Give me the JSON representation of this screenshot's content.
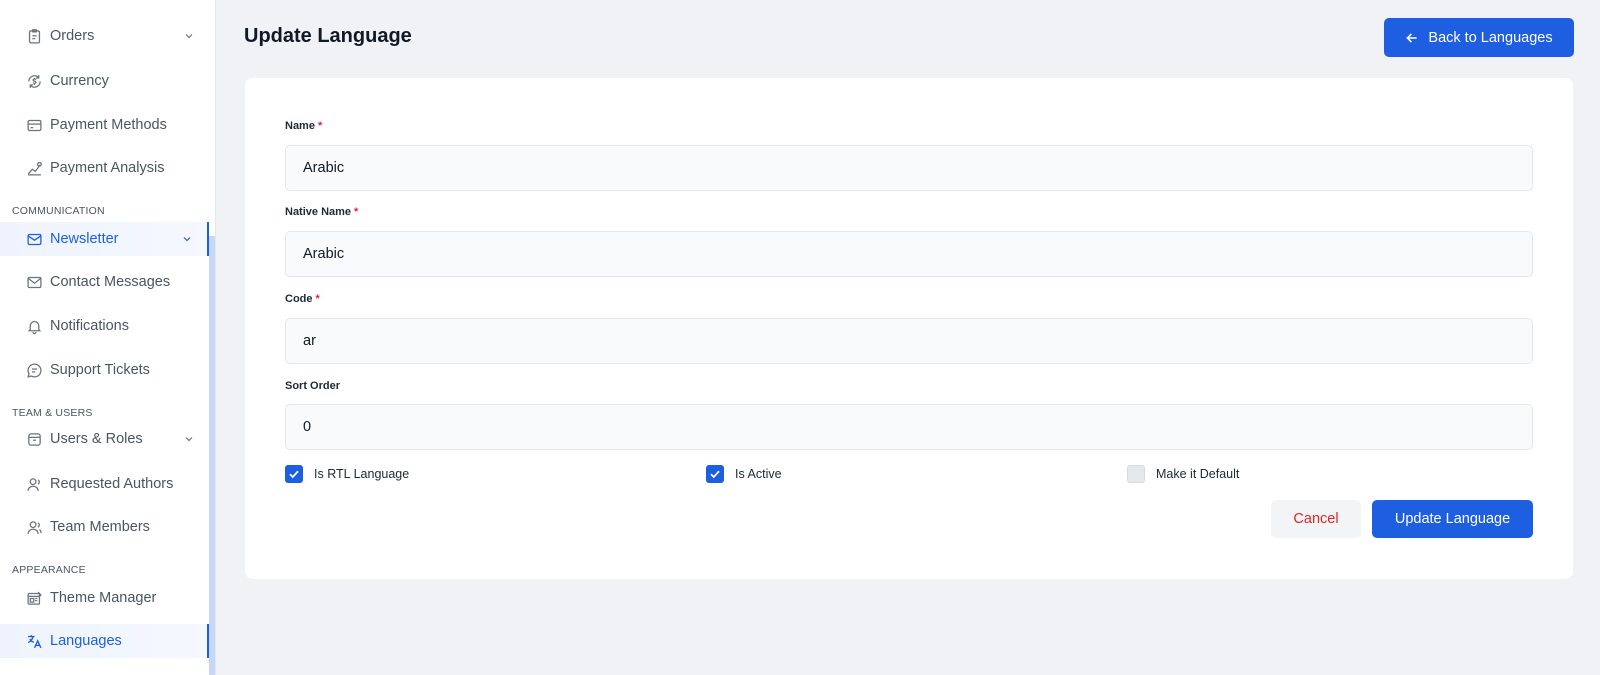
{
  "sidebar": {
    "items": [
      {
        "label": "Orders",
        "icon": "clipboard-icon"
      },
      {
        "label": "Currency",
        "icon": "currency-icon"
      },
      {
        "label": "Payment Methods",
        "icon": "credit-card-icon"
      },
      {
        "label": "Payment Analysis",
        "icon": "chart-line-icon"
      },
      {
        "label": "Newsletter",
        "icon": "mail-icon"
      },
      {
        "label": "Contact Messages",
        "icon": "envelope-icon"
      },
      {
        "label": "Notifications",
        "icon": "bell-icon"
      },
      {
        "label": "Support Tickets",
        "icon": "chat-bubble-icon"
      },
      {
        "label": "Users & Roles",
        "icon": "users-box-icon"
      },
      {
        "label": "Requested Authors",
        "icon": "user-icon"
      },
      {
        "label": "Team Members",
        "icon": "user-group-icon"
      },
      {
        "label": "Theme Manager",
        "icon": "theme-icon"
      },
      {
        "label": "Languages",
        "icon": "translate-icon"
      }
    ],
    "sections": {
      "communication": "COMMUNICATION",
      "team_users": "TEAM & USERS",
      "appearance": "APPEARANCE"
    }
  },
  "header": {
    "title": "Update Language",
    "back_label": "Back to Languages"
  },
  "form": {
    "name_label": "Name",
    "name_value": "Arabic",
    "native_name_label": "Native Name",
    "native_name_value": "Arabic",
    "code_label": "Code",
    "code_value": "ar",
    "sort_order_label": "Sort Order",
    "sort_order_value": "0",
    "required_mark": "*",
    "rtl_label": "Is RTL Language",
    "active_label": "Is Active",
    "default_label": "Make it Default",
    "rtl_checked": true,
    "active_checked": true,
    "default_checked": false,
    "cancel_label": "Cancel",
    "submit_label": "Update Language"
  },
  "colors": {
    "accent": "#1d5fe0",
    "danger": "#dc2626",
    "required": "#e11d48"
  }
}
